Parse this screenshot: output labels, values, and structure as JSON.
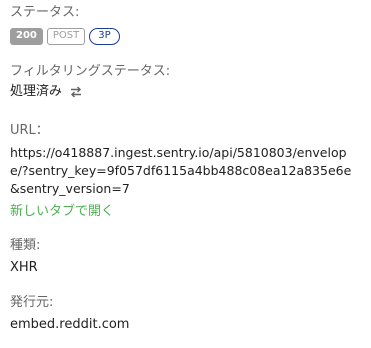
{
  "status_section": {
    "label": "ステータス:",
    "status_code": "200",
    "method": "POST",
    "party": "3P"
  },
  "filtering_section": {
    "label": "フィルタリングステータス:",
    "value": "処理済み",
    "icon": "swap-arrows-icon"
  },
  "url_section": {
    "label": "URL：",
    "value": "https://o418887.ingest.sentry.io/api/5810803/envelope/?sentry_key=9f057df6115a4bb488c08ea12a835e6e&sentry_version=7",
    "open_link": "新しいタブで開く"
  },
  "type_section": {
    "label": "種類:",
    "value": "XHR"
  },
  "initiator_section": {
    "label": "発行元:",
    "value": "embed.reddit.com"
  },
  "colors": {
    "label_text": "#666666",
    "value_text": "#212121",
    "status_badge_bg": "#9e9e9e",
    "party_badge_border": "#1a3d99",
    "link": "#4caf50"
  }
}
